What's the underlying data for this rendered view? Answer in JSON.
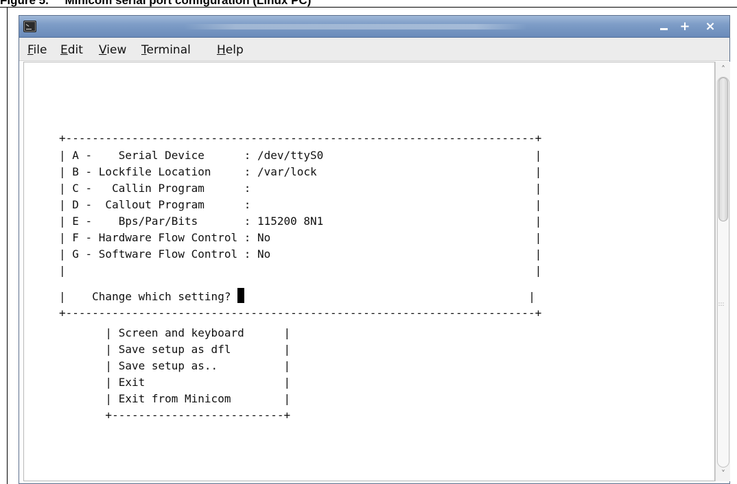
{
  "figure": {
    "caption": "Figure 5.     Minicom serial port configuration (Linux PC)"
  },
  "window": {
    "title_icon": "terminal-icon",
    "buttons": {
      "minimize_icon": "minimize-icon",
      "maximize_symbol": "+",
      "close_symbol": "×"
    }
  },
  "menu": {
    "items": [
      {
        "label": "File",
        "mnemonic": "F",
        "rest": "ile"
      },
      {
        "label": "Edit",
        "mnemonic": "E",
        "rest": "dit"
      },
      {
        "label": "View",
        "mnemonic": "V",
        "rest": "iew"
      },
      {
        "label": "Terminal",
        "mnemonic": "T",
        "rest": "erminal"
      },
      {
        "label": "Help",
        "mnemonic": "H",
        "rest": "elp"
      }
    ]
  },
  "terminal": {
    "box_top": "+-----------------------------------------------------------------------+",
    "settings": [
      "| A -    Serial Device      : /dev/ttyS0                                |",
      "| B - Lockfile Location     : /var/lock                                 |",
      "| C -   Callin Program      :                                           |",
      "| D -  Callout Program      :                                           |",
      "| E -    Bps/Par/Bits       : 115200 8N1                                |",
      "| F - Hardware Flow Control : No                                        |",
      "| G - Software Flow Control : No                                        |",
      "|                                                                       |"
    ],
    "prompt_left": "|    Change which setting? ",
    "prompt_right": "                                           |",
    "box_bottom": "+-----------------------------------------------------------------------+",
    "submenu": [
      "       | Screen and keyboard      |",
      "       | Save setup as dfl        |",
      "       | Save setup as..          |",
      "       | Exit                     |",
      "       | Exit from Minicom        |",
      "       +--------------------------+"
    ]
  },
  "scrollbar": {
    "up_arrow": "˄",
    "down_arrow": "˅",
    "grip": ":::",
    "thumb_start_fraction": 0.0,
    "thumb_end_fraction": 0.37
  }
}
